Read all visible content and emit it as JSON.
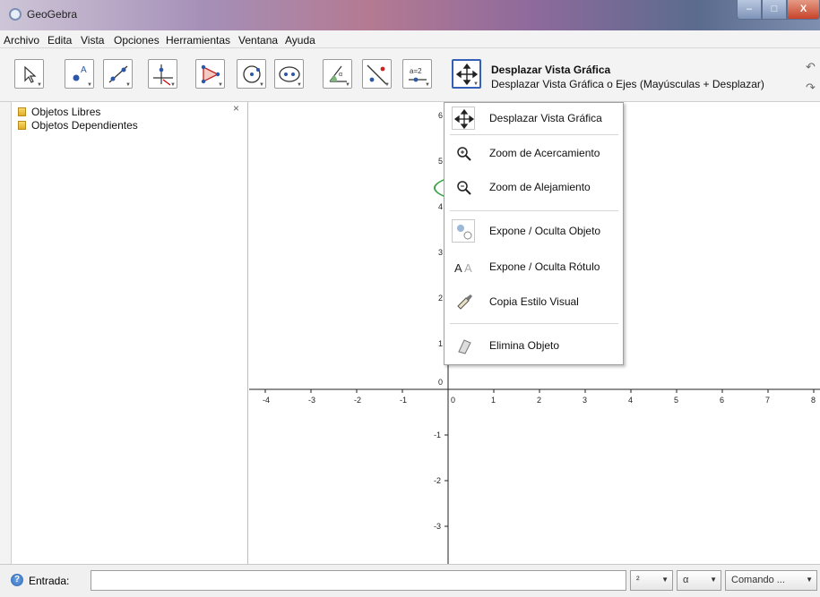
{
  "window": {
    "title": "GeoGebra",
    "min_label": "–",
    "max_label": "□",
    "close_label": "X"
  },
  "menubar": {
    "items": [
      "Archivo",
      "Edita",
      "Vista",
      "Opciones",
      "Herramientas",
      "Ventana",
      "Ayuda"
    ]
  },
  "toolbar": {
    "tools": [
      {
        "name": "move-tool",
        "icon": "arrow-cursor-icon"
      },
      {
        "name": "point-tool",
        "icon": "point-icon"
      },
      {
        "name": "line-tool",
        "icon": "line-icon"
      },
      {
        "name": "perpendicular-tool",
        "icon": "perpendicular-icon"
      },
      {
        "name": "polygon-tool",
        "icon": "polygon-icon"
      },
      {
        "name": "circle-tool",
        "icon": "circle-icon"
      },
      {
        "name": "conic-tool",
        "icon": "ellipse-icon"
      },
      {
        "name": "angle-tool",
        "icon": "angle-icon"
      },
      {
        "name": "reflect-tool",
        "icon": "reflect-icon"
      },
      {
        "name": "slider-tool",
        "icon": "slider-icon",
        "label": "a=2"
      },
      {
        "name": "move-view-tool",
        "icon": "move-arrows-icon"
      }
    ],
    "selected_title": "Desplazar Vista Gráfica",
    "selected_help": "Desplazar Vista Gráfica o Ejes (Mayúsculas + Desplazar)"
  },
  "algebra_view": {
    "folders": [
      "Objetos Libres",
      "Objetos Dependientes"
    ],
    "close_label": "×"
  },
  "graphics_view": {
    "x_ticks": [
      "-4",
      "-3",
      "-2",
      "-1",
      "0",
      "1",
      "2",
      "3",
      "4",
      "5",
      "6",
      "7",
      "8"
    ],
    "y_ticks": [
      "6",
      "5",
      "4",
      "3",
      "2",
      "1",
      "0",
      "-1",
      "-2",
      "-3"
    ]
  },
  "dropdown": {
    "items": [
      {
        "label": "Desplazar Vista Gráfica",
        "icon": "move-arrows-icon"
      },
      {
        "label": "Zoom de Acercamiento",
        "icon": "zoom-in-icon"
      },
      {
        "label": "Zoom de Alejamiento",
        "icon": "zoom-out-icon",
        "highlighted": true
      },
      {
        "label": "Expone / Oculta Objeto",
        "icon": "show-hide-object-icon"
      },
      {
        "label": "Expone / Oculta Rótulo",
        "icon": "show-hide-label-icon"
      },
      {
        "label": "Copia Estilo Visual",
        "icon": "copy-style-brush-icon"
      },
      {
        "label": "Elimina Objeto",
        "icon": "eraser-icon"
      }
    ],
    "highlight_color": "#3aa045"
  },
  "inputbar": {
    "label": "Entrada:",
    "value": "",
    "combo_exponent": "²",
    "combo_symbol": "α",
    "combo_command": "Comando ..."
  }
}
